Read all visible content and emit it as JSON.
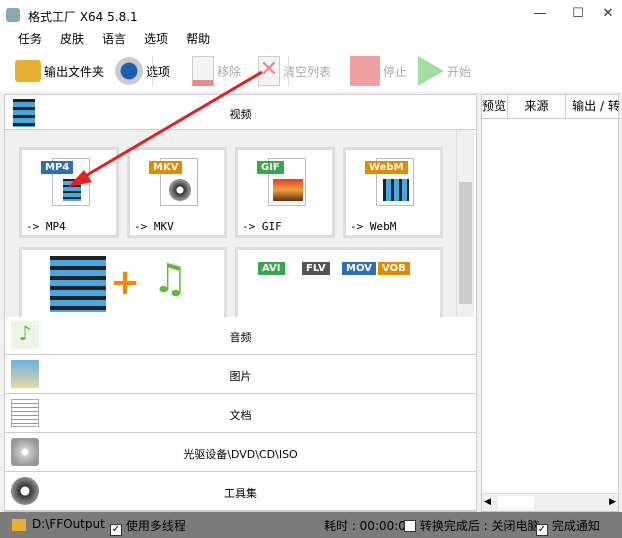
{
  "window": {
    "title": "格式工厂 X64 5.8.1"
  },
  "menu": [
    "任务",
    "皮肤",
    "语言",
    "选项",
    "帮助"
  ],
  "toolbar": {
    "output_folder": "输出文件夹",
    "options": "选项",
    "remove": "移除",
    "clear_list": "清空列表",
    "stop": "停止",
    "start": "开始"
  },
  "categories": {
    "video": "视频",
    "audio": "音频",
    "image": "图片",
    "document": "文档",
    "disc": "光驱设备\\DVD\\CD\\ISO",
    "tools": "工具集"
  },
  "tiles": [
    {
      "badge": "MP4",
      "caption": "-> MP4",
      "color": "#2d6fb6"
    },
    {
      "badge": "MKV",
      "caption": "-> MKV",
      "color": "#e08a00"
    },
    {
      "badge": "GIF",
      "caption": "-> GIF",
      "color": "#3aa64c"
    },
    {
      "badge": "WebM",
      "caption": "-> WebM",
      "color": "#e08a00"
    }
  ],
  "tile_row2_badges": [
    "AVI",
    "FLV",
    "MOV",
    "VOB"
  ],
  "right_panel": {
    "columns": [
      "预览",
      "来源",
      "输出 / 转"
    ]
  },
  "status": {
    "path": "D:\\FFOutput",
    "multithread": "使用多线程",
    "multithread_checked": true,
    "elapsed": "耗时 : 00:00:00",
    "after_done": "转换完成后 : 关闭电脑",
    "after_done_checked": false,
    "notify": "完成通知",
    "notify_checked": true
  }
}
